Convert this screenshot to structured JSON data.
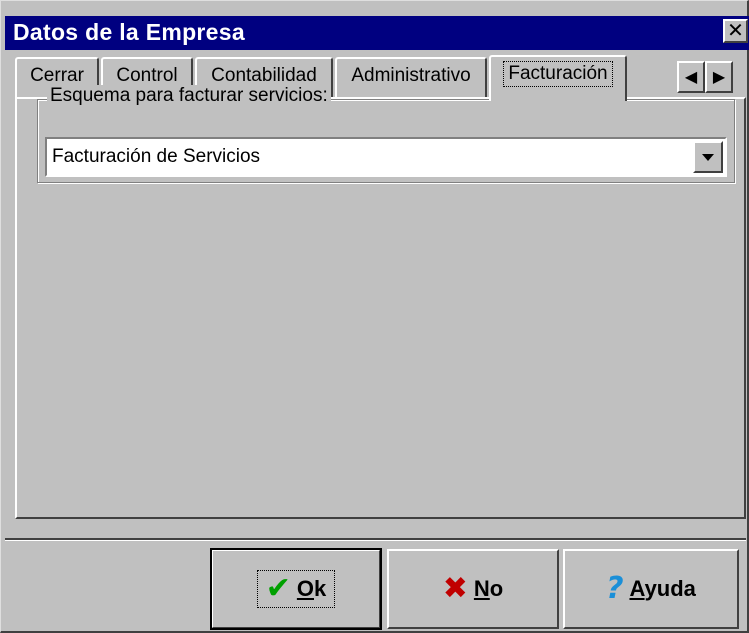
{
  "window": {
    "title": "Datos de la Empresa",
    "close_glyph": "✕"
  },
  "tabs": [
    {
      "label": "Cerrar"
    },
    {
      "label": "Control"
    },
    {
      "label": "Contabilidad"
    },
    {
      "label": "Administrativo"
    },
    {
      "label": "Facturación",
      "active": true
    }
  ],
  "tab_scroll": {
    "left_glyph": "◀",
    "right_glyph": "▶"
  },
  "group": {
    "legend": "Esquema para facturar servicios:",
    "combo_value": "Facturación de Servicios"
  },
  "buttons": {
    "ok": {
      "mnemonic": "O",
      "rest": "k",
      "icon": "✔",
      "icon_color": "#00a000"
    },
    "no": {
      "mnemonic": "N",
      "rest": "o",
      "icon": "✖",
      "icon_color": "#c00000"
    },
    "help": {
      "mnemonic": "A",
      "rest": "yuda",
      "icon": "?",
      "icon_color": "#1a8fd8"
    }
  },
  "colors": {
    "titlebar": "#000080",
    "face": "#c0c0c0"
  }
}
